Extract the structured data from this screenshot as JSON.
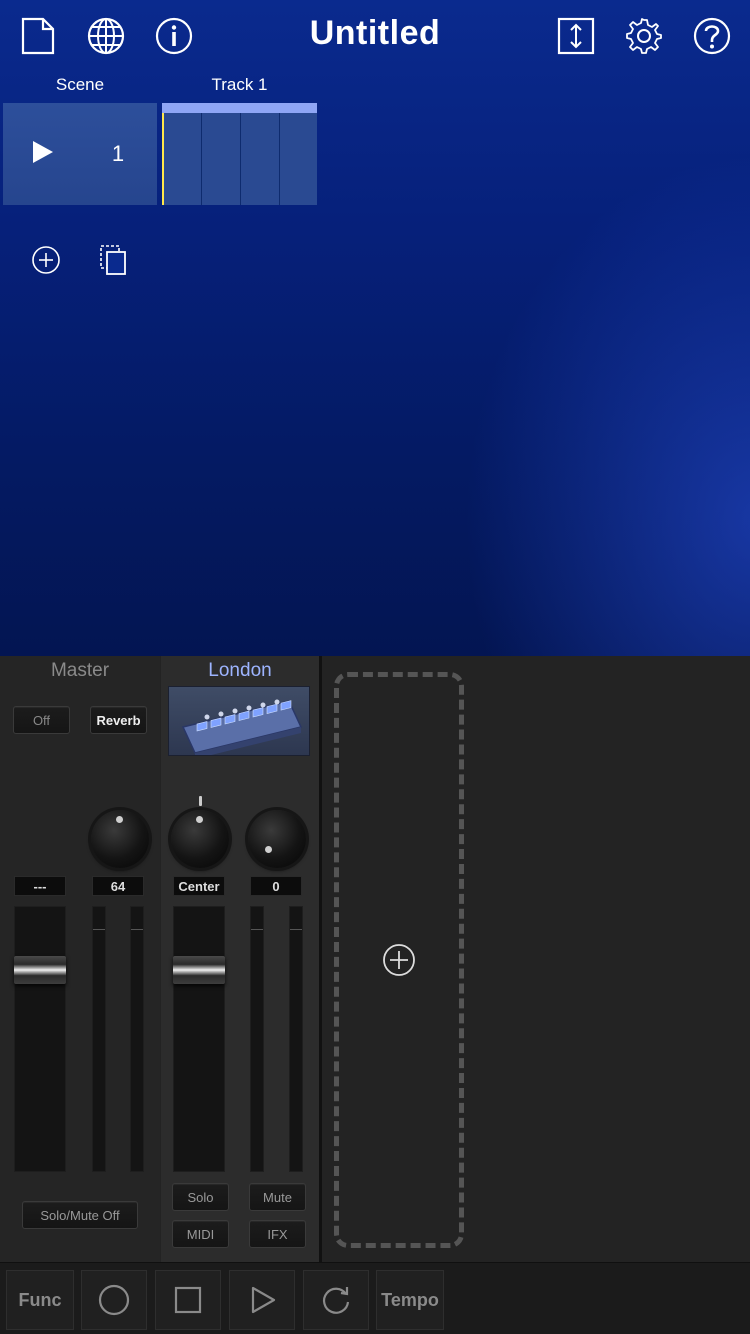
{
  "toolbar": {
    "title": "Untitled",
    "icons": [
      "new-document-icon",
      "globe-icon",
      "info-icon",
      "expand-vertical-icon",
      "gear-icon",
      "help-icon"
    ]
  },
  "session": {
    "scene_label": "Scene",
    "track_label": "Track 1",
    "scene_number": "1"
  },
  "mixer": {
    "master": {
      "name": "Master",
      "off_label": "Off",
      "reverb_label": "Reverb",
      "left_value": "---",
      "right_value": "64",
      "solo_mute_label": "Solo/Mute Off"
    },
    "track": {
      "name": "London",
      "pan_value": "Center",
      "send_value": "0",
      "solo_label": "Solo",
      "mute_label": "Mute",
      "midi_label": "MIDI",
      "ifx_label": "IFX"
    }
  },
  "transport": {
    "func_label": "Func",
    "tempo_label": "Tempo",
    "icons": [
      "record-icon",
      "stop-icon",
      "play-icon",
      "loop-icon"
    ]
  },
  "colors": {
    "accent_blue": "#8fa6f5",
    "playhead": "#ffe84a",
    "track_name": "#9db4ff"
  }
}
